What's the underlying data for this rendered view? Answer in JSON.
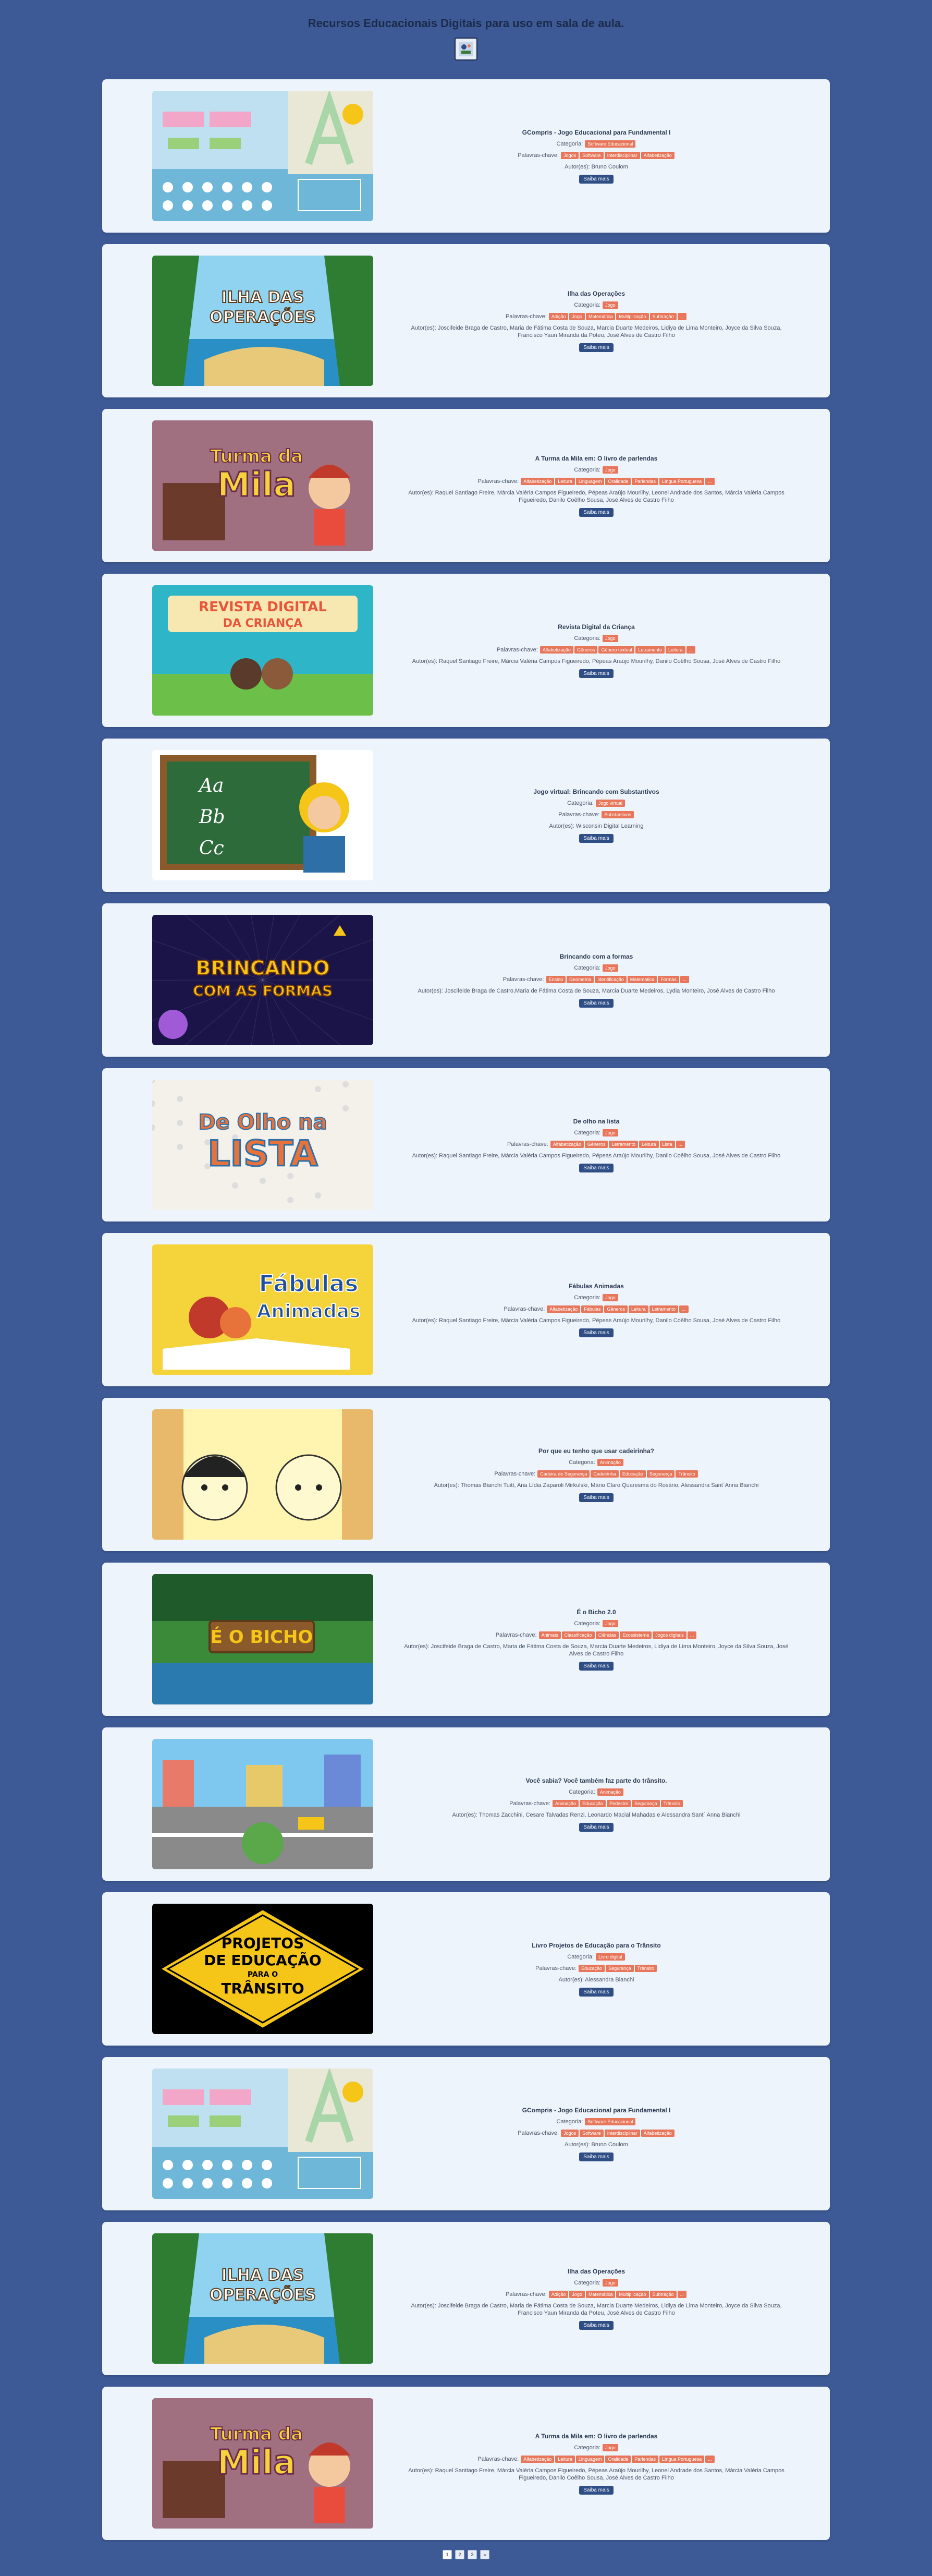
{
  "header": {
    "title": "Recursos Educacionais Digitais para uso em sala de aula."
  },
  "cards": [
    {
      "title": "GCompris - Jogo Educacional para Fundamental I",
      "category_label": "Categoria:",
      "category": "Software Educacional",
      "keywords_label": "Palavras-chave:",
      "keywords": [
        "Jogos",
        "Software",
        "Interdisciplinar",
        "Alfabetização"
      ],
      "authors": "Autor(es): Bruno Coulom",
      "button": "Saiba mais",
      "theme": "gcompris"
    },
    {
      "title": "Ilha das Operações",
      "category_label": "Categoria:",
      "category": "Jogo",
      "keywords_label": "Palavras-chave:",
      "keywords": [
        "Adição",
        "Jogo",
        "Matemática",
        "Multiplicação",
        "Subtração",
        "..."
      ],
      "authors": "Autor(es): Joscifeide Braga de Castro, Maria de Fátima Costa de Souza, Marcia Duarte Medeiros, Lidiya de Lima Monteiro, Joyce da Silva Souza, Francisco Yaun Miranda da Poteu, José Alves de Castro Filho",
      "button": "Saiba mais",
      "theme": "ilha"
    },
    {
      "title": "A Turma da Mila em: O livro de parlendas",
      "category_label": "Categoria:",
      "category": "Jogo",
      "keywords_label": "Palavras-chave:",
      "keywords": [
        "Alfabetização",
        "Leitura",
        "Linguagem",
        "Oralidade",
        "Parlendas",
        "Língua Portuguesa",
        "..."
      ],
      "authors": "Autor(es): Raquel Santiago Freire, Márcia Valéria Campos Figueiredo, Pépeas Araújo Mourilhy, Leonel Andrade dos Santos, Márcia Valéria Campos Figueiredo, Danilo Coêlho Sousa, José Alves de Castro Filho",
      "button": "Saiba mais",
      "theme": "mila"
    },
    {
      "title": "Revista Digital da Criança",
      "category_label": "Categoria:",
      "category": "Jogo",
      "keywords_label": "Palavras-chave:",
      "keywords": [
        "Alfabetização",
        "Gêneros",
        "Gênero textual",
        "Letramento",
        "Leitura",
        "..."
      ],
      "authors": "Autor(es): Raquel Santiago Freire, Márcia Valéria Campos Figueiredo, Pépeas Araújo Mourilhy, Danilo Coêlho Sousa, José Alves de Castro Filho",
      "button": "Saiba mais",
      "theme": "revista"
    },
    {
      "title": "Jogo virtual: Brincando com Substantivos",
      "category_label": "Categoria:",
      "category": "Jogo virtual",
      "keywords_label": "Palavras-chave:",
      "keywords": [
        "Substantivos"
      ],
      "authors": "Autor(es): Wisconsin Digital Learning",
      "button": "Saiba mais",
      "theme": "substantivos"
    },
    {
      "title": "Brincando com a formas",
      "category_label": "Categoria:",
      "category": "Jogo",
      "keywords_label": "Palavras-chave:",
      "keywords": [
        "Ensino",
        "Geometria",
        "Identificação",
        "Matemática",
        "Formas",
        "..."
      ],
      "authors": "Autor(es): Joscifeide Braga de Castro,Maria de Fátima Costa de Souza, Marcia Duarte Medeiros, Lydia Monteiro, José Alves de Castro Filho",
      "button": "Saiba mais",
      "theme": "formas"
    },
    {
      "title": "De olho na lista",
      "category_label": "Categoria:",
      "category": "Jogo",
      "keywords_label": "Palavras-chave:",
      "keywords": [
        "Alfabetização",
        "Gêneros",
        "Letramento",
        "Leitura",
        "Lista",
        "..."
      ],
      "authors": "Autor(es): Raquel Santiago Freire, Márcia Valéria Campos Figueiredo, Pépeas Araújo Mourilhy, Danilo Coêlho Sousa, José Alves de Castro Filho",
      "button": "Saiba mais",
      "theme": "lista"
    },
    {
      "title": "Fábulas Animadas",
      "category_label": "Categoria:",
      "category": "Jogo",
      "keywords_label": "Palavras-chave:",
      "keywords": [
        "Alfabetização",
        "Fábulas",
        "Gêneros",
        "Leitura",
        "Letramento",
        "..."
      ],
      "authors": "Autor(es): Raquel Santiago Freire, Márcia Valéria Campos Figueiredo, Pépeas Araújo Mourilhy, Danilo Coêlho Sousa, José Alves de Castro Filho",
      "button": "Saiba mais",
      "theme": "fabulas"
    },
    {
      "title": "Por que eu tenho que usar cadeirinha?",
      "category_label": "Categoria:",
      "category": "Animação",
      "keywords_label": "Palavras-chave:",
      "keywords": [
        "Cadeira de Segurança",
        "Cadeirinha",
        "Educação",
        "Segurança",
        "Trânsito"
      ],
      "authors": "Autor(es): Thomas Bianchi Tuitt, Ana Lídia Zaparoli Mirkulski, Mário Claro Quaresma do Rosário, Alessandra Sant´Anna Bianchi",
      "button": "Saiba mais",
      "theme": "cadeirinha"
    },
    {
      "title": "É o Bicho 2.0",
      "category_label": "Categoria:",
      "category": "Jogo",
      "keywords_label": "Palavras-chave:",
      "keywords": [
        "Animais",
        "Classificação",
        "Ciências",
        "Ecossistema",
        "Jogos digitais",
        "..."
      ],
      "authors": "Autor(es): Joscifeide Braga de Castro, Maria de Fátima Costa de Souza, Marcia Duarte Medeiros, Lidiya de Lima Monteiro, Joyce da Silva Souza, José Alves de Castro Filho",
      "button": "Saiba mais",
      "theme": "bicho"
    },
    {
      "title": "Você sabia? Você também faz parte do trânsito.",
      "category_label": "Categoria:",
      "category": "Animação",
      "keywords_label": "Palavras-chave:",
      "keywords": [
        "Animação",
        "Educação",
        "Pedestre",
        "Segurança",
        "Trânsito"
      ],
      "authors": "Autor(es): Thomas Zacchini, Cesare Talvadas Renzi, Leonardo Macial Mahadas e Alessandra Sant´ Anna Bianchi",
      "button": "Saiba mais",
      "theme": "voce-sabia"
    },
    {
      "title": "Livro Projetos de Educação para o Trânsito",
      "category_label": "Categoria:",
      "category": "Livro digital",
      "keywords_label": "Palavras-chave:",
      "keywords": [
        "Educação",
        "Segurança",
        "Trânsito"
      ],
      "authors": "Autor(es): Alessandra Bianchi",
      "button": "Saiba mais",
      "theme": "projetos"
    },
    {
      "title": "GCompris - Jogo Educacional para Fundamental I",
      "category_label": "Categoria:",
      "category": "Software Educacional",
      "keywords_label": "Palavras-chave:",
      "keywords": [
        "Jogos",
        "Software",
        "Interdisciplinar",
        "Alfabetização"
      ],
      "authors": "Autor(es): Bruno Coulom",
      "button": "Saiba mais",
      "theme": "gcompris"
    },
    {
      "title": "Ilha das Operações",
      "category_label": "Categoria:",
      "category": "Jogo",
      "keywords_label": "Palavras-chave:",
      "keywords": [
        "Adição",
        "Jogo",
        "Matemática",
        "Multiplicação",
        "Subtração",
        "..."
      ],
      "authors": "Autor(es): Joscifeide Braga de Castro, Maria de Fátima Costa de Souza, Marcia Duarte Medeiros, Lidiya de Lima Monteiro, Joyce da Silva Souza, Francisco Yaun Miranda da Poteu, José Alves de Castro Filho",
      "button": "Saiba mais",
      "theme": "ilha"
    },
    {
      "title": "A Turma da Mila em: O livro de parlendas",
      "category_label": "Categoria:",
      "category": "Jogo",
      "keywords_label": "Palavras-chave:",
      "keywords": [
        "Alfabetização",
        "Leitura",
        "Linguagem",
        "Oralidade",
        "Parlendas",
        "Língua Portuguesa",
        "..."
      ],
      "authors": "Autor(es): Raquel Santiago Freire, Márcia Valéria Campos Figueiredo, Pépeas Araújo Mourilhy, Leonel Andrade dos Santos, Márcia Valéria Campos Figueiredo, Danilo Coêlho Sousa, José Alves de Castro Filho",
      "button": "Saiba mais",
      "theme": "mila"
    }
  ],
  "thumb_text": {
    "ilha": [
      "ILHA DAS",
      "OPERAÇÕES"
    ],
    "mila": [
      "Turma da",
      "Mila"
    ],
    "revista": [
      "REVISTA DIGITAL",
      "DA CRIANÇA"
    ],
    "substantivos": [
      "Aa",
      "Bb",
      "Cc"
    ],
    "formas": [
      "BRINCANDO",
      "COM AS FORMAS"
    ],
    "lista": [
      "De Olho na",
      "LISTA"
    ],
    "fabulas": [
      "Fábulas",
      "Animadas"
    ],
    "bicho": [
      "É O BICHO"
    ],
    "projetos": [
      "PROJETOS",
      "DE EDUCAÇÃO",
      "PARA O",
      "TRÂNSITO"
    ]
  },
  "pagination": [
    "1",
    "2",
    "3",
    "»"
  ],
  "colors": {
    "background": "#3d5a96",
    "card": "#eef4fb",
    "badge": "#e8765a",
    "button": "#2f4e86"
  }
}
